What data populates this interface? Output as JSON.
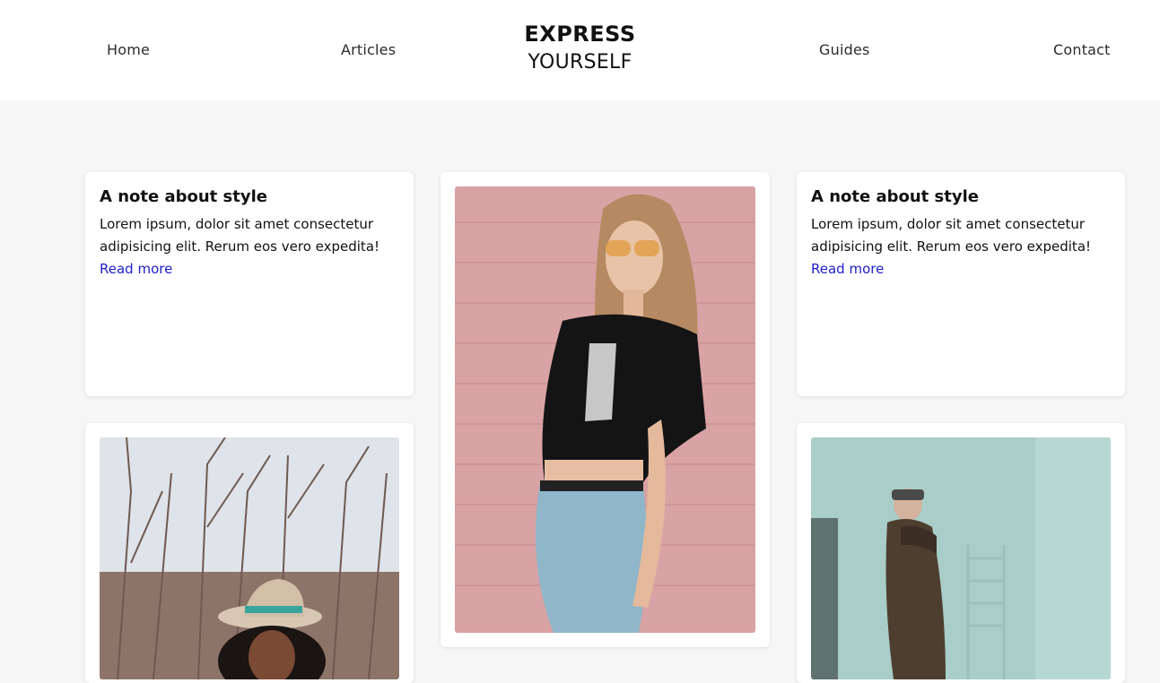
{
  "header": {
    "nav_left": [
      "Home",
      "Articles"
    ],
    "nav_right": [
      "Guides",
      "Contact"
    ],
    "logo": {
      "line1": "EXPRESS",
      "line2": "YOURSELF"
    }
  },
  "cards": [
    {
      "title": "A note about style",
      "body": "Lorem ipsum, dolor sit amet consectetur adipisicing elit. Rerum eos vero expedita!",
      "link": "Read more"
    },
    {
      "title": "A note about style",
      "body": "Lorem ipsum, dolor sit amet consectetur adipisicing elit. Rerum eos vero expedita!",
      "link": "Read more"
    }
  ],
  "colors": {
    "page_bg": "#f6f6f6",
    "card_bg": "#ffffff",
    "link": "#2020c8"
  },
  "images": [
    {
      "name": "woman-hat-trees-photo"
    },
    {
      "name": "woman-pink-wall-photo"
    },
    {
      "name": "man-coat-photo"
    }
  ]
}
